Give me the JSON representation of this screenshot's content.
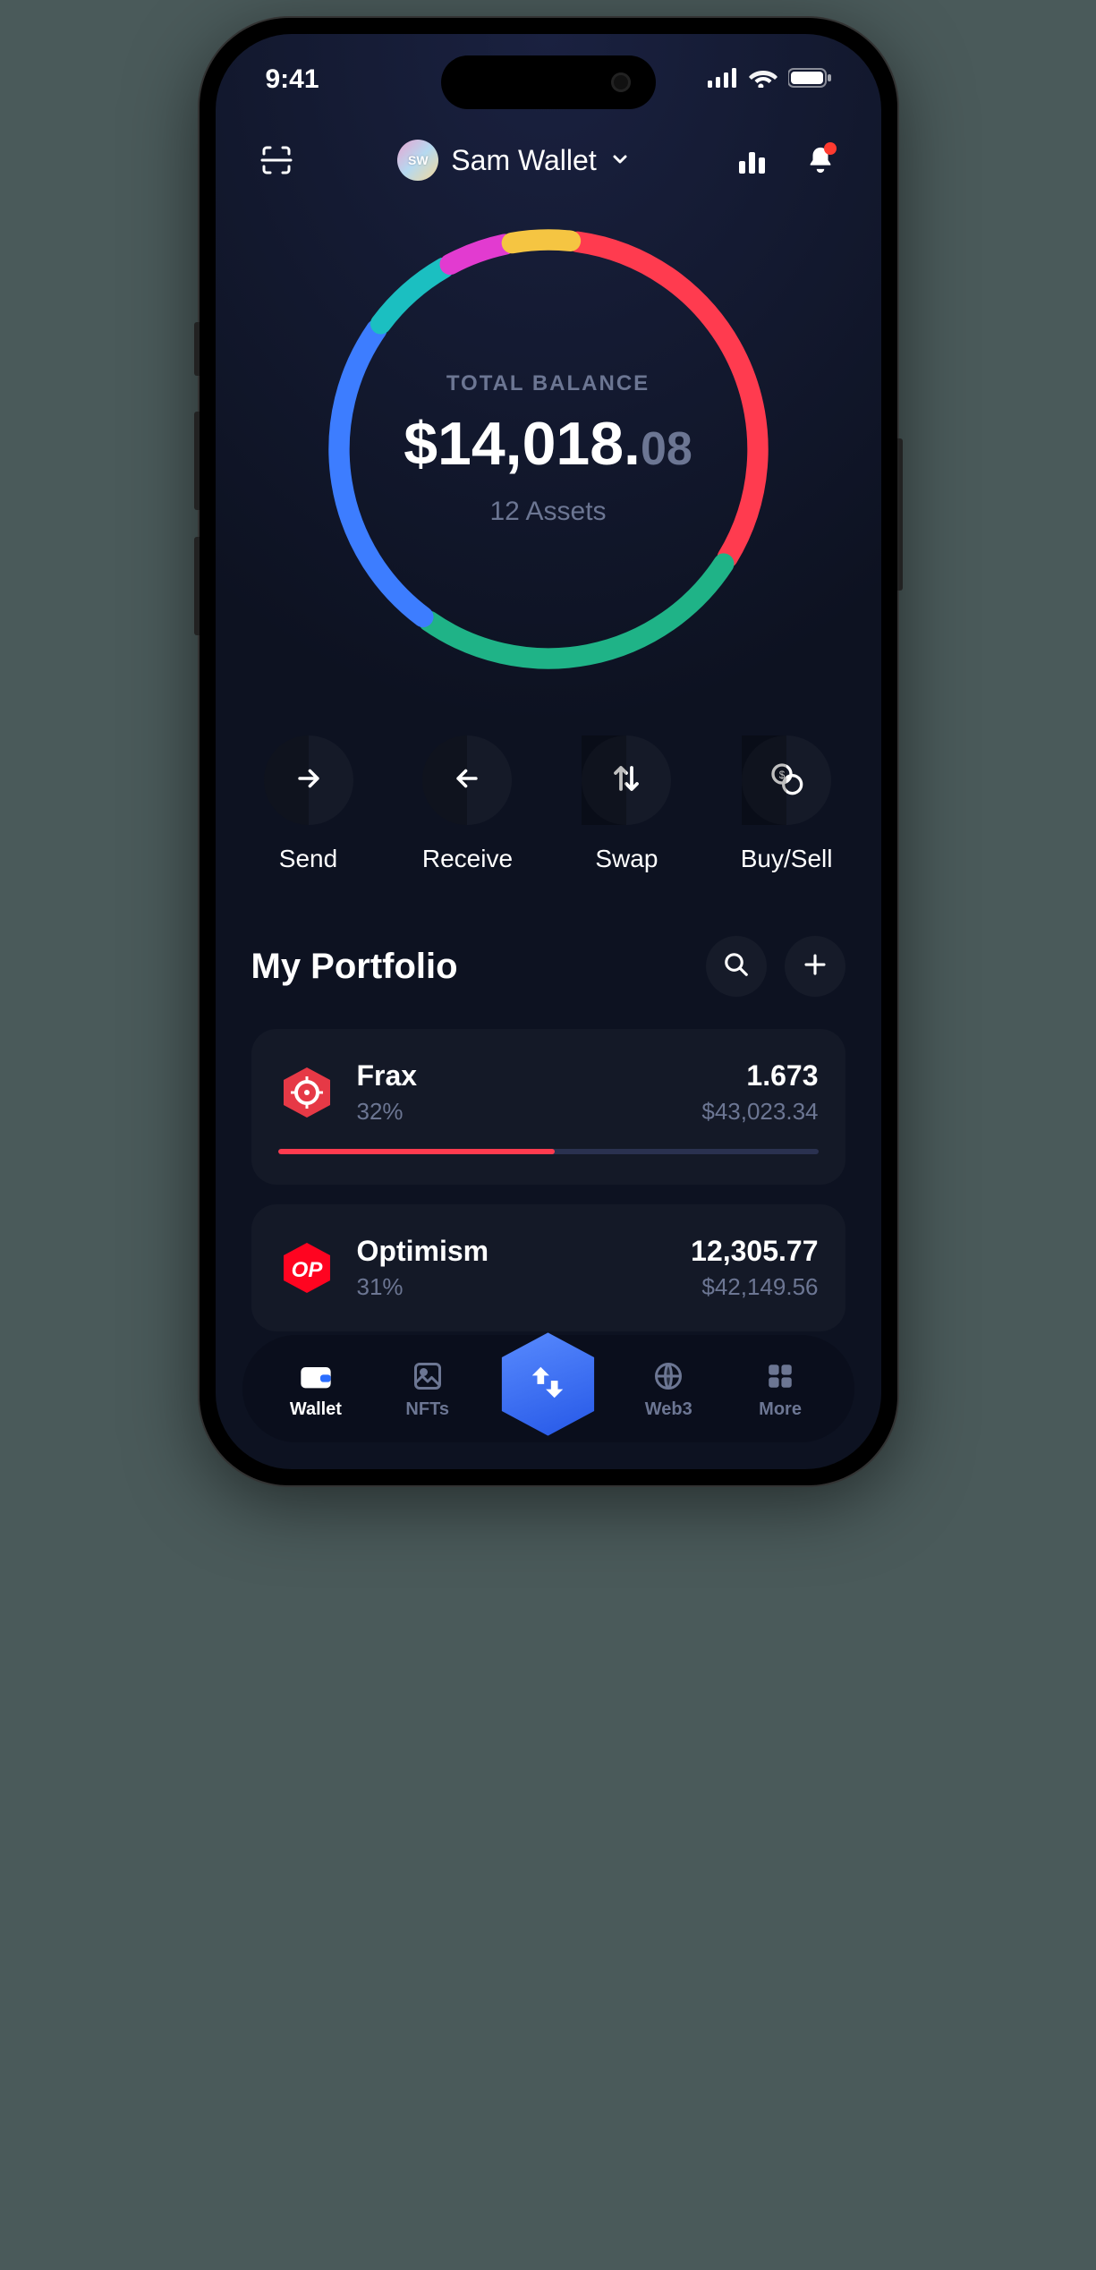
{
  "statusbar": {
    "time": "9:41"
  },
  "header": {
    "wallet_name": "Sam Wallet",
    "avatar_initials": "SW"
  },
  "balance": {
    "label": "TOTAL BALANCE",
    "currency": "$",
    "main": "14,018.",
    "cents": "08",
    "assets_count": "12 Assets"
  },
  "chart_data": {
    "type": "pie",
    "title": "Total balance allocation",
    "segments": [
      {
        "name": "Red (Frax)",
        "color": "#ff3b4f",
        "percent": 32
      },
      {
        "name": "Green",
        "color": "#1fb387",
        "percent": 26
      },
      {
        "name": "Blue",
        "color": "#3d7dff",
        "percent": 25
      },
      {
        "name": "Teal",
        "color": "#1bbfc1",
        "percent": 7
      },
      {
        "name": "Magenta",
        "color": "#e23bd0",
        "percent": 5
      },
      {
        "name": "Yellow",
        "color": "#f5c542",
        "percent": 5
      }
    ]
  },
  "actions": {
    "send": "Send",
    "receive": "Receive",
    "swap": "Swap",
    "buysell": "Buy/Sell"
  },
  "portfolio": {
    "title": "My Portfolio",
    "assets": [
      {
        "name": "Frax",
        "icon": "frax",
        "percent": "32%",
        "percent_num": 32,
        "amount": "1.673",
        "value": "$43,023.34",
        "color": "#e63946"
      },
      {
        "name": "Optimism",
        "icon": "optimism",
        "percent": "31%",
        "percent_num": 31,
        "amount": "12,305.77",
        "value": "$42,149.56",
        "color": "#ff0420"
      }
    ]
  },
  "nav": {
    "wallet": "Wallet",
    "nfts": "NFTs",
    "web3": "Web3",
    "more": "More"
  }
}
